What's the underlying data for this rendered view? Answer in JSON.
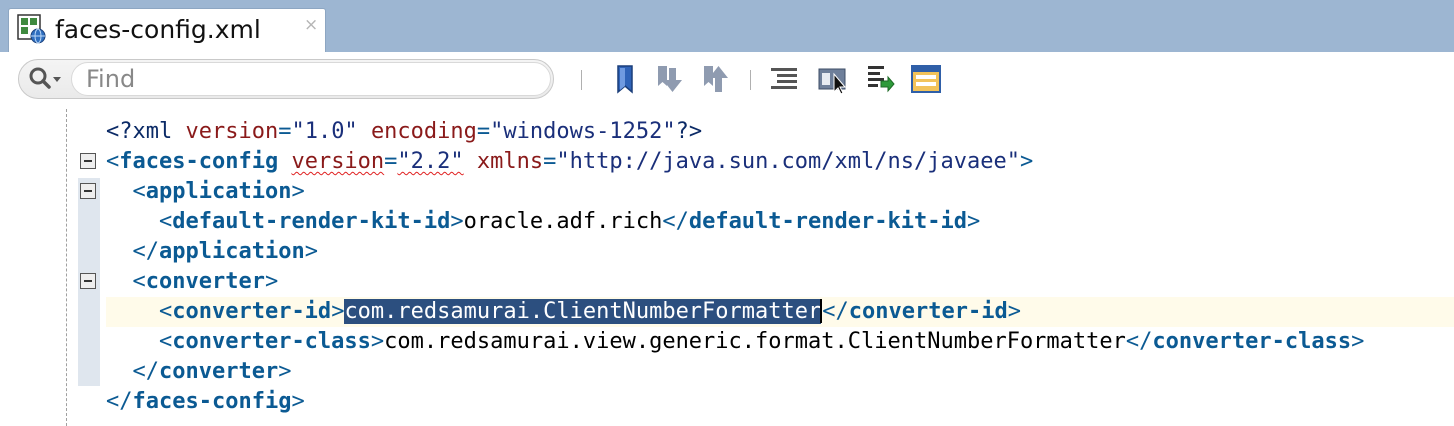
{
  "tab": {
    "title": "faces-config.xml",
    "close": "×",
    "icon": "xml-file-icon"
  },
  "toolbar": {
    "search_placeholder": "Find",
    "search_value": "",
    "buttons": [
      "bookmark-icon",
      "previous-bookmark-icon",
      "next-bookmark-icon",
      "structure-icon",
      "breakpoints-icon",
      "log-icon",
      "layout-icon"
    ]
  },
  "editor": {
    "lines": {
      "l1": {
        "open": "<?xml ",
        "a1": "version",
        "eq1": "=",
        "v1": "\"1.0\"",
        "sp": " ",
        "a2": "encoding",
        "eq2": "=",
        "v2": "\"windows-1252\"",
        "close": "?>"
      },
      "l2": {
        "lt": "<",
        "tag": "faces-config",
        "sp1": " ",
        "a1": "version",
        "eq1": "=",
        "v1": "\"2.2\"",
        "sp2": " ",
        "a2": "xmlns",
        "eq2": "=",
        "v2": "\"http://java.sun.com/xml/ns/javaee\"",
        "gt": ">"
      },
      "l3": {
        "indent": "  ",
        "lt": "<",
        "tag": "application",
        "gt": ">"
      },
      "l4": {
        "indent": "    ",
        "lt": "<",
        "tag": "default-render-kit-id",
        "gt": ">",
        "text": "oracle.adf.rich",
        "clt": "</",
        "ctag": "default-render-kit-id",
        "cgt": ">"
      },
      "l5": {
        "indent": "  ",
        "lt": "</",
        "tag": "application",
        "gt": ">"
      },
      "l6": {
        "indent": "  ",
        "lt": "<",
        "tag": "converter",
        "gt": ">"
      },
      "l7": {
        "indent": "    ",
        "lt": "<",
        "tag": "converter-id",
        "gt": ">",
        "text": "com.redsamurai.ClientNumberFormatter",
        "clt": "</",
        "ctag": "converter-id",
        "cgt": ">"
      },
      "l8": {
        "indent": "    ",
        "lt": "<",
        "tag": "converter-class",
        "gt": ">",
        "text": "com.redsamurai.view.generic.format.ClientNumberFormatter",
        "clt": "</",
        "ctag": "converter-class",
        "cgt": ">"
      },
      "l9": {
        "indent": "  ",
        "lt": "</",
        "tag": "converter",
        "gt": ">"
      },
      "l10": {
        "lt": "</",
        "tag": "faces-config",
        "gt": ">"
      }
    }
  },
  "colors": {
    "tabbar_bg": "#9db6d2",
    "tag": "#0b5a93",
    "attribute": "#8a1a1a",
    "value": "#1a2f7a",
    "selection": "#2c4f7f",
    "current_line": "#fffbea"
  }
}
